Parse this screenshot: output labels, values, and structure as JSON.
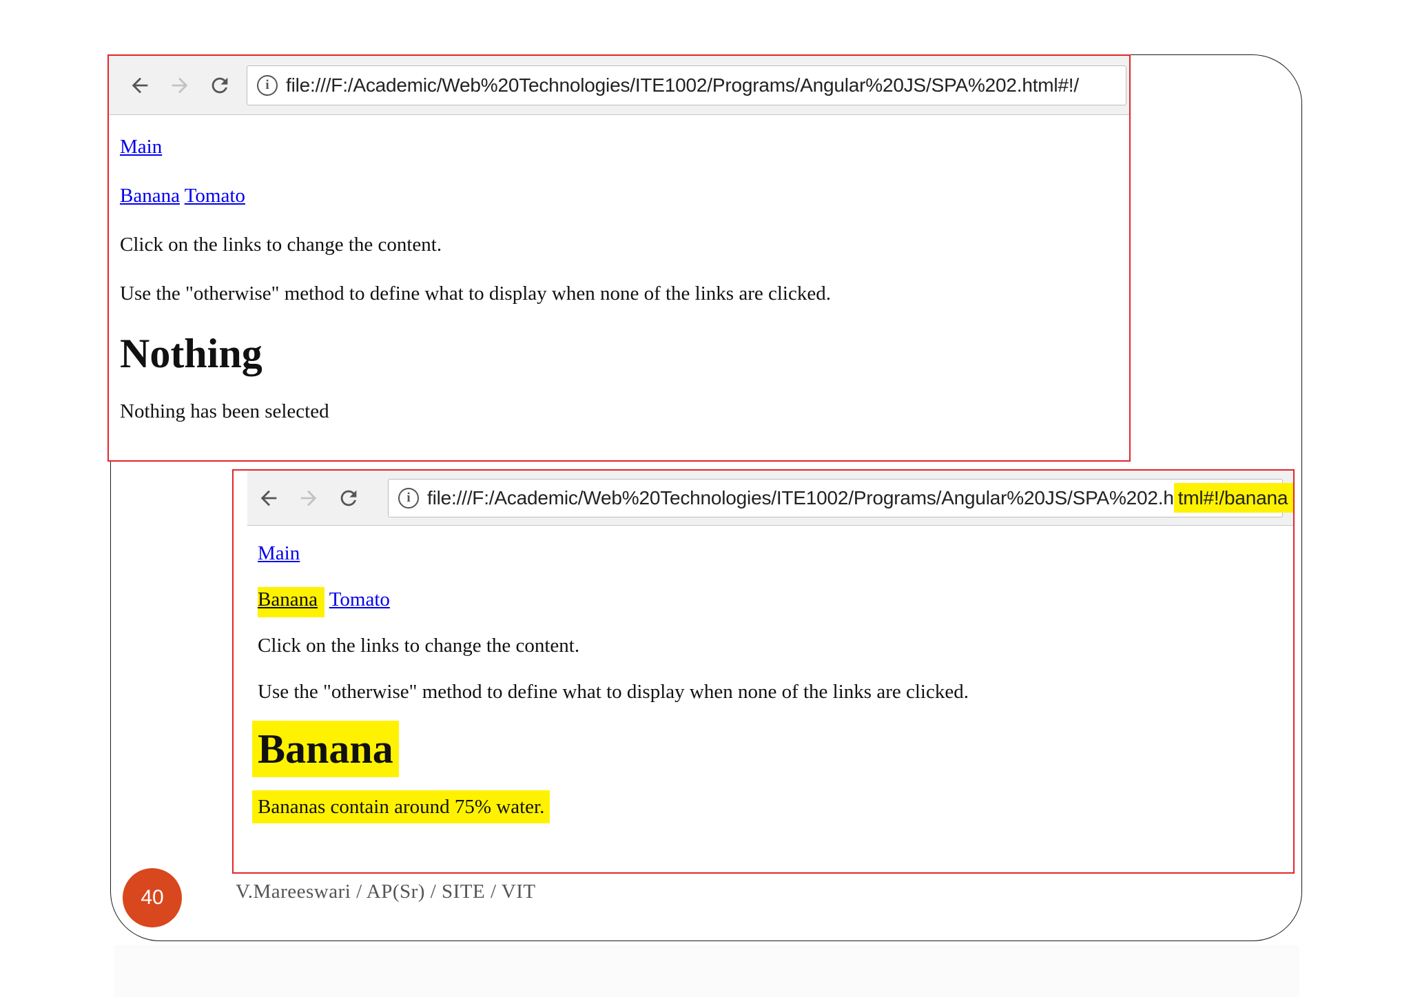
{
  "browser1": {
    "url": "file:///F:/Academic/Web%20Technologies/ITE1002/Programs/Angular%20JS/SPA%202.html#!/"
  },
  "page1": {
    "link_main": "Main",
    "link_banana": "Banana",
    "link_tomato": "Tomato",
    "instruction": "Click on the links to change the content.",
    "note": "Use the \"otherwise\" method to define what to display when none of the links are clicked.",
    "heading": "Nothing",
    "body": "Nothing has been selected"
  },
  "browser2": {
    "url_prefix": "file:///F:/Academic/Web%20Technologies/ITE1002/Programs/Angular%20JS/SPA%202.h",
    "url_highlight": "tml#!/banana"
  },
  "page2": {
    "link_main": "Main",
    "link_banana": "Banana",
    "link_tomato": "Tomato",
    "instruction": "Click on the links to change the content.",
    "note": "Use the \"otherwise\" method to define what to display when none of the links are clicked.",
    "heading": "Banana",
    "body": "Bananas contain around 75% water."
  },
  "slide": {
    "page_number": "40",
    "footer": "V.Mareeswari  /  AP(Sr)  /  SITE  /  VIT"
  },
  "colors": {
    "frame_border": "#e0262a",
    "highlight": "#fff200",
    "page_badge": "#d9471e",
    "link": "#0000ee"
  },
  "icons": [
    "back-arrow-icon",
    "forward-arrow-icon",
    "reload-icon",
    "info-icon"
  ]
}
